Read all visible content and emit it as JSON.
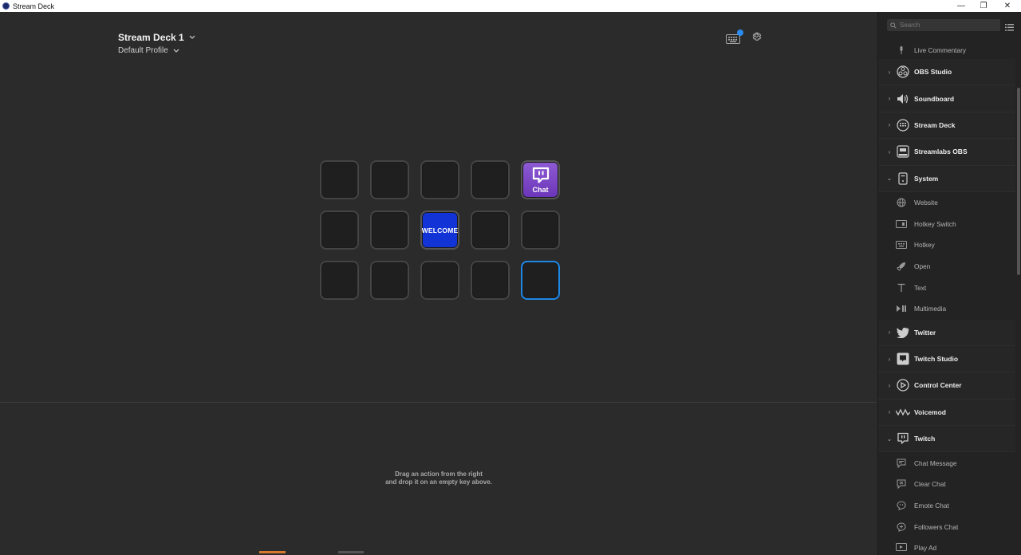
{
  "window": {
    "title": "Stream Deck",
    "controls": {
      "minimize": "—",
      "maximize": "❐",
      "close": "✕"
    }
  },
  "header": {
    "device_name": "Stream Deck 1",
    "profile_name": "Default Profile"
  },
  "keys": {
    "chat_label": "Chat",
    "welcome_label": "WELCOME"
  },
  "hint": {
    "line1": "Drag an action from the right",
    "line2": "and drop it on an empty key above."
  },
  "sidebar": {
    "search_placeholder": "Search",
    "items": [
      {
        "type": "sub",
        "label": "Live Commentary",
        "icon": "microphone-icon"
      },
      {
        "type": "cat",
        "label": "OBS Studio",
        "icon": "obs-icon",
        "expanded": false
      },
      {
        "type": "cat",
        "label": "Soundboard",
        "icon": "speaker-icon",
        "expanded": false
      },
      {
        "type": "cat",
        "label": "Stream Deck",
        "icon": "stream-deck-icon",
        "expanded": false
      },
      {
        "type": "cat",
        "label": "Streamlabs OBS",
        "icon": "streamlabs-icon",
        "expanded": false
      },
      {
        "type": "cat",
        "label": "System",
        "icon": "system-icon",
        "expanded": true
      },
      {
        "type": "sub",
        "label": "Website",
        "icon": "globe-icon"
      },
      {
        "type": "sub",
        "label": "Hotkey Switch",
        "icon": "hotkey-switch-icon"
      },
      {
        "type": "sub",
        "label": "Hotkey",
        "icon": "hotkey-icon"
      },
      {
        "type": "sub",
        "label": "Open",
        "icon": "rocket-icon"
      },
      {
        "type": "sub",
        "label": "Text",
        "icon": "text-icon"
      },
      {
        "type": "sub",
        "label": "Multimedia",
        "icon": "play-pause-icon"
      },
      {
        "type": "cat",
        "label": "Twitter",
        "icon": "twitter-icon",
        "expanded": false
      },
      {
        "type": "cat",
        "label": "Twitch Studio",
        "icon": "twitch-studio-icon",
        "expanded": false
      },
      {
        "type": "cat",
        "label": "Control Center",
        "icon": "control-center-icon",
        "expanded": false
      },
      {
        "type": "cat",
        "label": "Voicemod",
        "icon": "voicemod-icon",
        "expanded": false
      },
      {
        "type": "cat",
        "label": "Twitch",
        "icon": "twitch-icon",
        "expanded": true
      },
      {
        "type": "sub",
        "label": "Chat Message",
        "icon": "chat-message-icon"
      },
      {
        "type": "sub",
        "label": "Clear Chat",
        "icon": "clear-chat-icon"
      },
      {
        "type": "sub",
        "label": "Emote Chat",
        "icon": "emote-chat-icon"
      },
      {
        "type": "sub",
        "label": "Followers Chat",
        "icon": "followers-chat-icon"
      },
      {
        "type": "sub",
        "label": "Play Ad",
        "icon": "play-ad-icon"
      }
    ]
  },
  "colors": {
    "background": "#2b2b2b",
    "sidebar": "#232323",
    "selected_key": "#1e88e5",
    "chat_key": "#7b47c6",
    "welcome_key": "#1233d6",
    "notification_dot": "#2a8cf0"
  }
}
